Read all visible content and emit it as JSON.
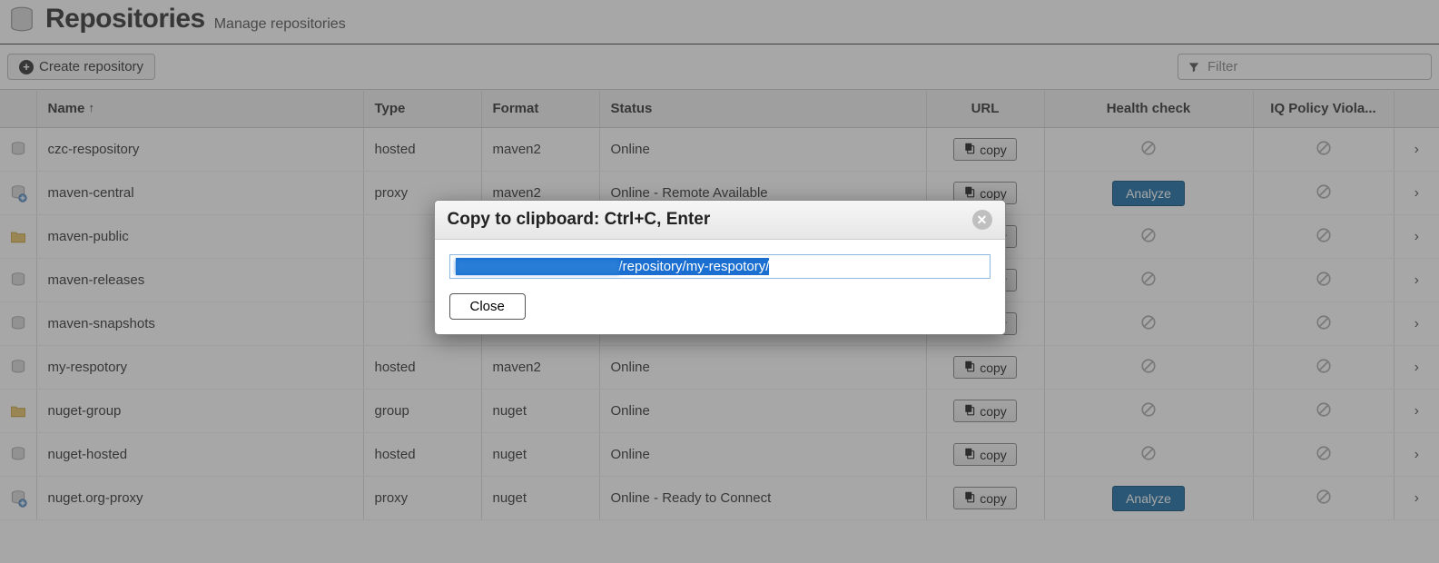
{
  "header": {
    "title": "Repositories",
    "subtitle": "Manage repositories"
  },
  "toolbar": {
    "create_label": "Create repository",
    "filter_placeholder": "Filter"
  },
  "columns": {
    "name": "Name",
    "type": "Type",
    "format": "Format",
    "status": "Status",
    "url": "URL",
    "health": "Health check",
    "iq": "IQ Policy Viola..."
  },
  "buttons": {
    "copy": "copy",
    "analyze": "Analyze",
    "close": "Close"
  },
  "rows": [
    {
      "icon": "db",
      "name": "czc-respository",
      "type": "hosted",
      "format": "maven2",
      "status": "Online",
      "health": "disabled",
      "iq": "disabled"
    },
    {
      "icon": "db-proxy",
      "name": "maven-central",
      "type": "proxy",
      "format": "maven2",
      "status": "Online - Remote Available",
      "health": "analyze",
      "iq": "disabled"
    },
    {
      "icon": "folder",
      "name": "maven-public",
      "type": "",
      "format": "",
      "status": "",
      "health": "disabled",
      "iq": "disabled"
    },
    {
      "icon": "db",
      "name": "maven-releases",
      "type": "",
      "format": "",
      "status": "",
      "health": "disabled",
      "iq": "disabled"
    },
    {
      "icon": "db",
      "name": "maven-snapshots",
      "type": "",
      "format": "",
      "status": "",
      "health": "disabled",
      "iq": "disabled"
    },
    {
      "icon": "db",
      "name": "my-respotory",
      "type": "hosted",
      "format": "maven2",
      "status": "Online",
      "health": "disabled",
      "iq": "disabled"
    },
    {
      "icon": "folder",
      "name": "nuget-group",
      "type": "group",
      "format": "nuget",
      "status": "Online",
      "health": "disabled",
      "iq": "disabled"
    },
    {
      "icon": "db",
      "name": "nuget-hosted",
      "type": "hosted",
      "format": "nuget",
      "status": "Online",
      "health": "disabled",
      "iq": "disabled"
    },
    {
      "icon": "db-proxy",
      "name": "nuget.org-proxy",
      "type": "proxy",
      "format": "nuget",
      "status": "Online - Ready to Connect",
      "health": "analyze",
      "iq": "disabled"
    }
  ],
  "modal": {
    "title": "Copy to clipboard: Ctrl+C, Enter",
    "url_visible_suffix": "/repository/my-respotory/"
  }
}
